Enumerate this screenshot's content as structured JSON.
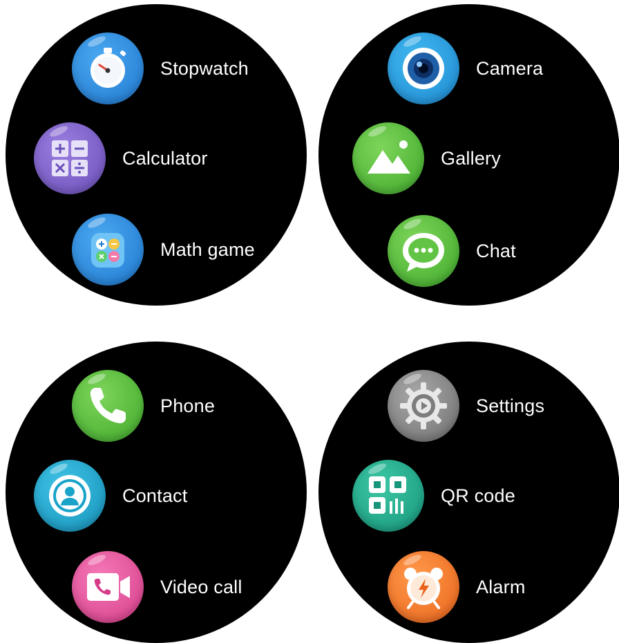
{
  "watches": [
    {
      "apps": [
        {
          "label": "Stopwatch",
          "icon": "stopwatch-icon",
          "color": "#2f8fe0"
        },
        {
          "label": "Calculator",
          "icon": "calculator-icon",
          "color": "#7b5fc7"
        },
        {
          "label": "Math game",
          "icon": "math-game-icon",
          "color": "#2f8fe0"
        }
      ]
    },
    {
      "apps": [
        {
          "label": "Camera",
          "icon": "camera-icon",
          "color": "#2a9be0"
        },
        {
          "label": "Gallery",
          "icon": "gallery-icon",
          "color": "#5bbf3a"
        },
        {
          "label": "Chat",
          "icon": "chat-icon",
          "color": "#5bbf3a"
        }
      ]
    },
    {
      "apps": [
        {
          "label": "Phone",
          "icon": "phone-icon",
          "color": "#5bbf3a"
        },
        {
          "label": "Contact",
          "icon": "contact-icon",
          "color": "#1ea6c8"
        },
        {
          "label": "Video call",
          "icon": "video-call-icon",
          "color": "#e8509c"
        }
      ]
    },
    {
      "apps": [
        {
          "label": "Settings",
          "icon": "settings-icon",
          "color": "#8a8a8a"
        },
        {
          "label": "QR code",
          "icon": "qr-code-icon",
          "color": "#22a98a"
        },
        {
          "label": "Alarm",
          "icon": "alarm-icon",
          "color": "#f2782a"
        }
      ]
    }
  ]
}
